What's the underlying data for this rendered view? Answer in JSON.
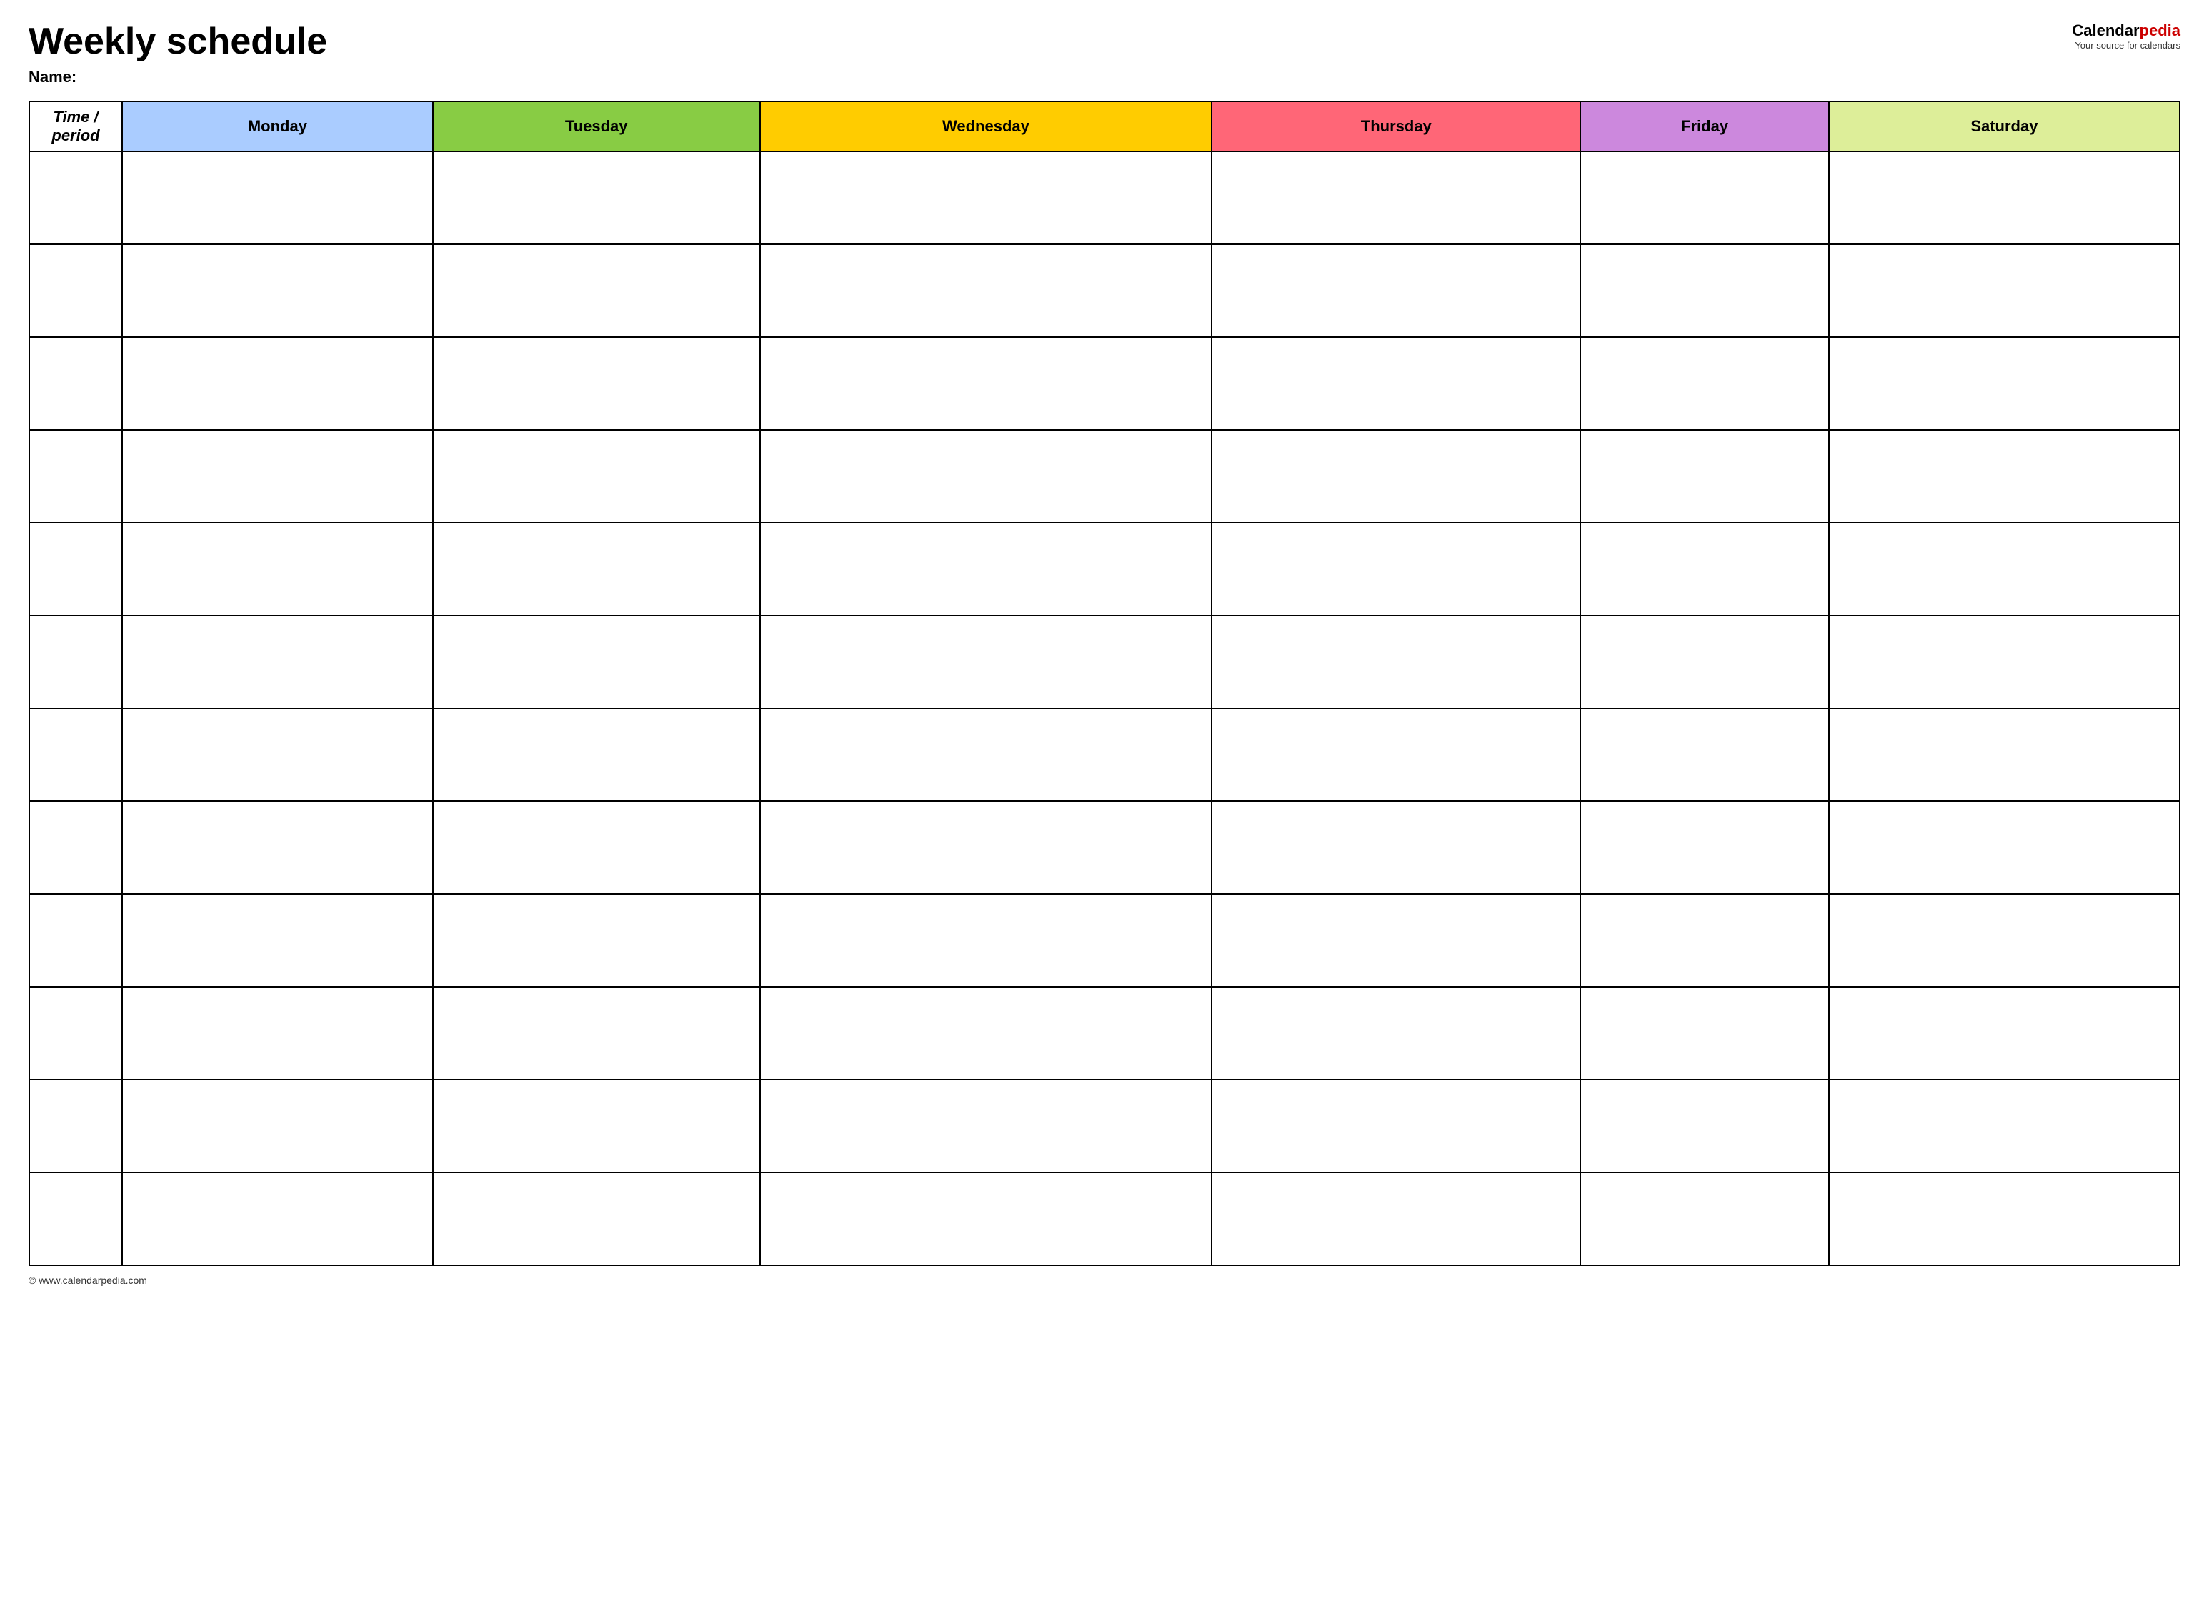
{
  "header": {
    "title": "Weekly schedule",
    "name_label": "Name:",
    "logo_calendar": "Calendar",
    "logo_pedia": "pedia",
    "logo_tagline": "Your source for calendars",
    "footer_url": "© www.calendarpedia.com"
  },
  "table": {
    "columns": [
      {
        "id": "time",
        "label": "Time / period",
        "color": "#ffffff"
      },
      {
        "id": "monday",
        "label": "Monday",
        "color": "#aaccff"
      },
      {
        "id": "tuesday",
        "label": "Tuesday",
        "color": "#88cc44"
      },
      {
        "id": "wednesday",
        "label": "Wednesday",
        "color": "#ffcc00"
      },
      {
        "id": "thursday",
        "label": "Thursday",
        "color": "#ff6677"
      },
      {
        "id": "friday",
        "label": "Friday",
        "color": "#cc88dd"
      },
      {
        "id": "saturday",
        "label": "Saturday",
        "color": "#ddee99"
      }
    ],
    "rows": 12
  }
}
